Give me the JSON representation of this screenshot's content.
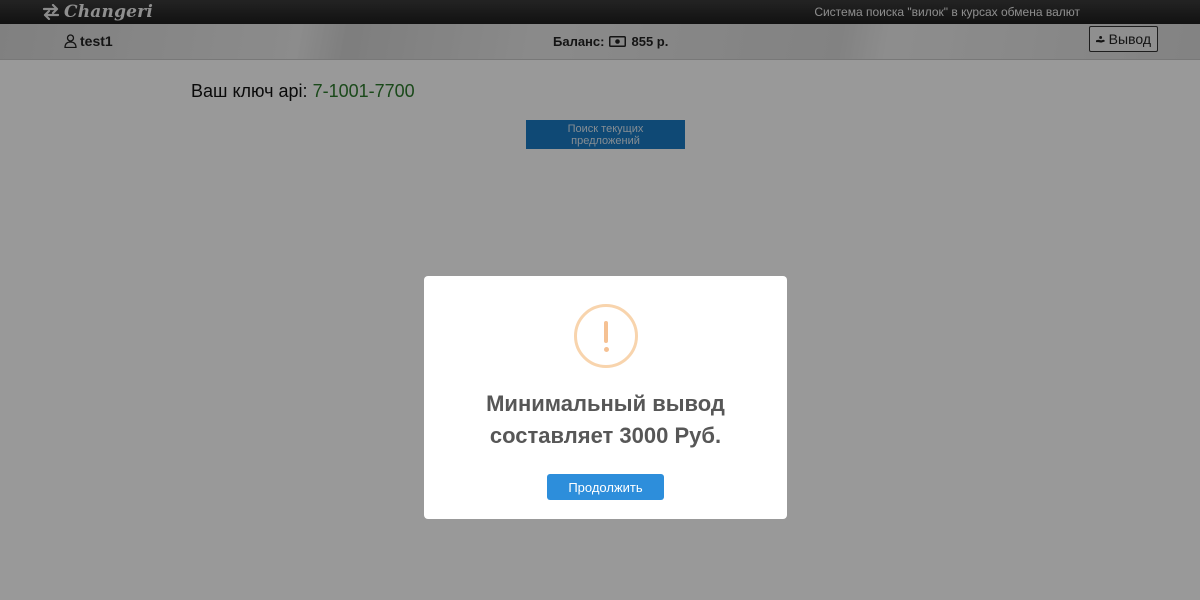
{
  "header": {
    "brand_name": "Changeri",
    "tagline": "Система поиска \"вилок\" в курсах обмена валют"
  },
  "userbar": {
    "username": "test1",
    "balance_label": "Баланс:",
    "balance_value": "855 р.",
    "withdraw_label": "Вывод"
  },
  "main": {
    "api_key_label": "Ваш ключ api:",
    "api_key_value": "7-1001-7700",
    "search_button": "Поиск текущих предложений"
  },
  "modal": {
    "icon": "warning-icon",
    "message": "Минимальный вывод составляет 3000 Руб.",
    "continue_button": "Продолжить"
  },
  "colors": {
    "accent_blue": "#2d8edb",
    "search_button_bg": "#1a7ac3",
    "api_key_green": "#2c7a2c",
    "warning_orange": "#f8d4ad",
    "topbar_dark": "#2a2a2a"
  }
}
